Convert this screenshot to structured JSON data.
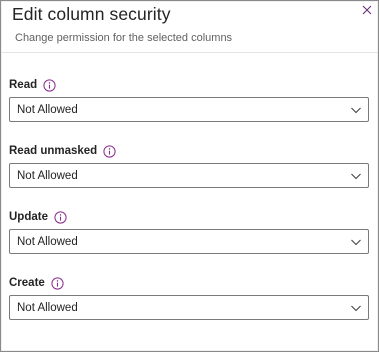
{
  "dialog": {
    "title": "Edit column security",
    "subtitle": "Change permission for the selected columns",
    "close_icon": "close-icon"
  },
  "fields": [
    {
      "label": "Read",
      "value": "Not Allowed",
      "info_icon": "info-icon"
    },
    {
      "label": "Read unmasked",
      "value": "Not Allowed",
      "info_icon": "info-icon"
    },
    {
      "label": "Update",
      "value": "Not Allowed",
      "info_icon": "info-icon"
    },
    {
      "label": "Create",
      "value": "Not Allowed",
      "info_icon": "info-icon"
    }
  ],
  "colors": {
    "info_icon": "#8b2b8c",
    "border": "#7a7a7a",
    "text": "#242424",
    "subtitle": "#616161"
  }
}
